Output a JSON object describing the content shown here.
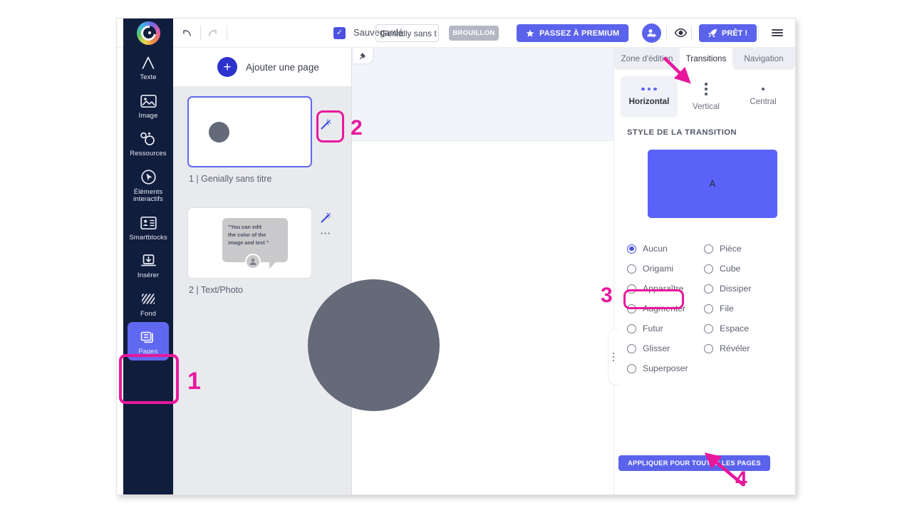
{
  "topbar": {
    "logo_icon": "genially-logo-icon",
    "undo_icon": "undo-arrow-icon",
    "redo_icon": "redo-arrow-icon",
    "saved_check_icon": "check-icon",
    "saved_label": "Sauvegardé",
    "title_value": "Genially sans t",
    "title_placeholder": "Genially sans titre",
    "draft_badge": "BROUILLON",
    "premium_label": "PASSEZ À PREMIUM",
    "premium_icon": "star-icon",
    "share_icon": "add-person-icon",
    "preview_icon": "eye-icon",
    "ready_label": "PRÊT !",
    "ready_icon": "rocket-icon",
    "menu_icon": "hamburger-menu-icon"
  },
  "sidebar": {
    "items": [
      {
        "label": "Texte",
        "icon": "letter-a-icon",
        "active": false
      },
      {
        "label": "Image",
        "icon": "image-icon",
        "active": false
      },
      {
        "label": "Ressources",
        "icon": "shapes-icon",
        "active": false
      },
      {
        "label": "Éléments\ninteractifs",
        "label_line1": "Éléments",
        "label_line2": "interactifs",
        "icon": "cursor-circle-icon",
        "active": false
      },
      {
        "label": "Smartblocks",
        "icon": "smartblocks-icon",
        "active": false
      },
      {
        "label": "Insérer",
        "icon": "insert-icon",
        "active": false
      },
      {
        "label": "Fond",
        "icon": "hatch-pattern-icon",
        "active": false
      },
      {
        "label": "Pages",
        "icon": "pages-stack-icon",
        "active": true
      }
    ]
  },
  "pages_panel": {
    "add_page_label": "Ajouter une page",
    "add_page_icon": "plus-icon",
    "pages": [
      {
        "caption": "1 |  Genially sans titre",
        "selected": true,
        "wand_icon": "magic-wand-icon",
        "thumb_type": "circle"
      },
      {
        "caption": "2 |  Text/Photo",
        "selected": false,
        "wand_icon": "magic-wand-icon",
        "more_icon": "more-options-icon",
        "thumb_type": "speech-bubble",
        "bubble_text": "”You can edit the color of the image and text ”",
        "bubble_line1": "”You can edit",
        "bubble_line2": "the color of the",
        "bubble_line3": "image and text  ”",
        "bubble_avatar_icon": "user-avatar-icon"
      }
    ]
  },
  "canvas": {
    "pin_icon": "pin-icon",
    "shape": "grey-circle"
  },
  "right_panel": {
    "handle_icon": "drag-handle-dots-icon",
    "tabs": [
      {
        "label": "Zone d'édition",
        "active": false
      },
      {
        "label": "Transitions",
        "active": true
      },
      {
        "label": "Navigation",
        "active": false
      }
    ],
    "orientations": [
      {
        "label": "Horizontal",
        "icon": "dots-horizontal-icon",
        "active": true
      },
      {
        "label": "Vertical",
        "icon": "dots-vertical-icon",
        "active": false
      },
      {
        "label": "Central",
        "icon": "dot-center-icon",
        "active": false
      }
    ],
    "style_section_title": "STYLE DE LA TRANSITION",
    "preview": {
      "letter": "A",
      "color": "#5a63f7"
    },
    "transition_options": [
      {
        "label": "Aucun",
        "checked": true
      },
      {
        "label": "Pièce",
        "checked": false
      },
      {
        "label": "Origami",
        "checked": false
      },
      {
        "label": "Cube",
        "checked": false
      },
      {
        "label": "Apparaître",
        "checked": false
      },
      {
        "label": "Dissiper",
        "checked": false
      },
      {
        "label": "Augmenter",
        "checked": false
      },
      {
        "label": "File",
        "checked": false
      },
      {
        "label": "Futur",
        "checked": false
      },
      {
        "label": "Espace",
        "checked": false
      },
      {
        "label": "Glisser",
        "checked": false
      },
      {
        "label": "Révéler",
        "checked": false
      },
      {
        "label": "Superposer",
        "checked": false
      }
    ],
    "apply_button": "APPLIQUER POUR TOUTES LES PAGES"
  },
  "annotations": {
    "color": "#e8189c",
    "markers": [
      {
        "number": "1",
        "target": "sidebar-item-pages"
      },
      {
        "number": "2",
        "target": "page-1-magic-wand-button"
      },
      {
        "number": "3",
        "target": "transition-option-aucun"
      },
      {
        "number": "4",
        "target": "apply-all-pages-button"
      }
    ]
  }
}
